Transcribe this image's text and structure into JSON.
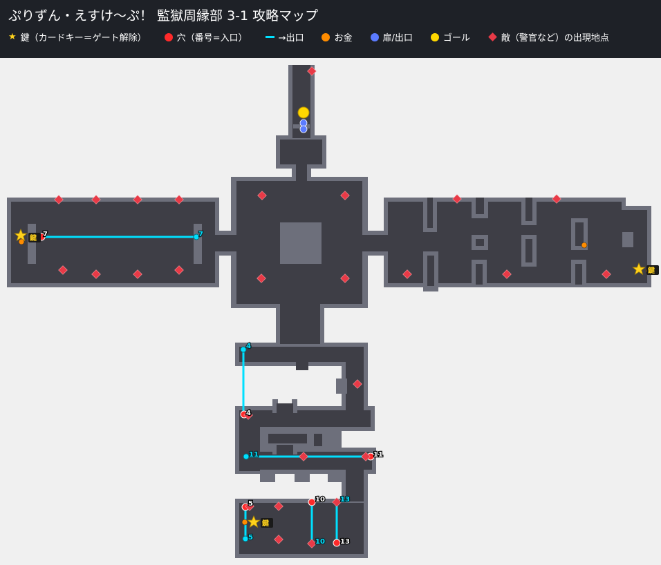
{
  "title": "ぷりずん・えすけ〜ぷ！ 監獄周縁部 3-1 攻略マップ",
  "legend": [
    {
      "icon": "star-icon",
      "label": "鍵（カードキー＝ゲート解除）"
    },
    {
      "icon": "red-dot-icon",
      "label": "穴（番号=入口）"
    },
    {
      "icon": "cyan-dash-icon",
      "label": "→出口"
    },
    {
      "icon": "orange-dot-icon",
      "label": "お金"
    },
    {
      "icon": "blue-dot-icon",
      "label": "扉/出口"
    },
    {
      "icon": "yellow-dot-icon",
      "label": "ゴール"
    },
    {
      "icon": "red-diamond-icon",
      "label": "敵（警官など）の出現地点"
    }
  ],
  "key_label": "鍵",
  "hole_labels": [
    "7",
    "4",
    "11",
    "5",
    "10",
    "13"
  ],
  "colors": {
    "header_bg": "#1e2127",
    "wall": "#6d6f7b",
    "floor": "#3e3e46",
    "background": "#f0f0f0",
    "hole": "#ff2a2a",
    "exit_line": "#00e0ff",
    "coin": "#ff8c00",
    "door": "#5b7bff",
    "goal": "#ffd700",
    "enemy": "#e83a47",
    "key": "#ffd21c"
  }
}
